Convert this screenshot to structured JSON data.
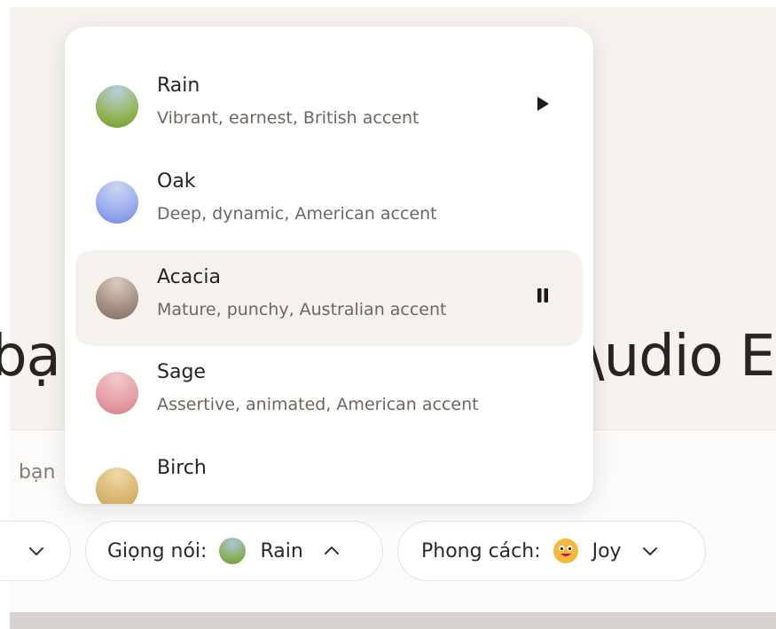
{
  "headline": {
    "left": "bại",
    "right": "\\udio E"
  },
  "composer": {
    "placeholder_fragment": "bạn"
  },
  "dropdown": {
    "voices": [
      {
        "name": "Rain",
        "description": "Vibrant, earnest, British accent",
        "action": "play"
      },
      {
        "name": "Oak",
        "description": "Deep, dynamic, American accent",
        "action": ""
      },
      {
        "name": "Acacia",
        "description": "Mature, punchy, Australian accent",
        "action": "pause"
      },
      {
        "name": "Sage",
        "description": "Assertive, animated, American accent",
        "action": ""
      },
      {
        "name": "Birch",
        "description": "",
        "action": ""
      }
    ]
  },
  "toolbar": {
    "voice_label": "Giọng nói:",
    "voice_value": "Rain",
    "style_label": "Phong cách:",
    "style_value": "Joy"
  },
  "colors": {
    "rain": "#8fb36c",
    "oak": "#8fa5ec",
    "acacia": "#9a8a7e",
    "sage": "#e39aa0",
    "birch": "#d9b46a"
  }
}
